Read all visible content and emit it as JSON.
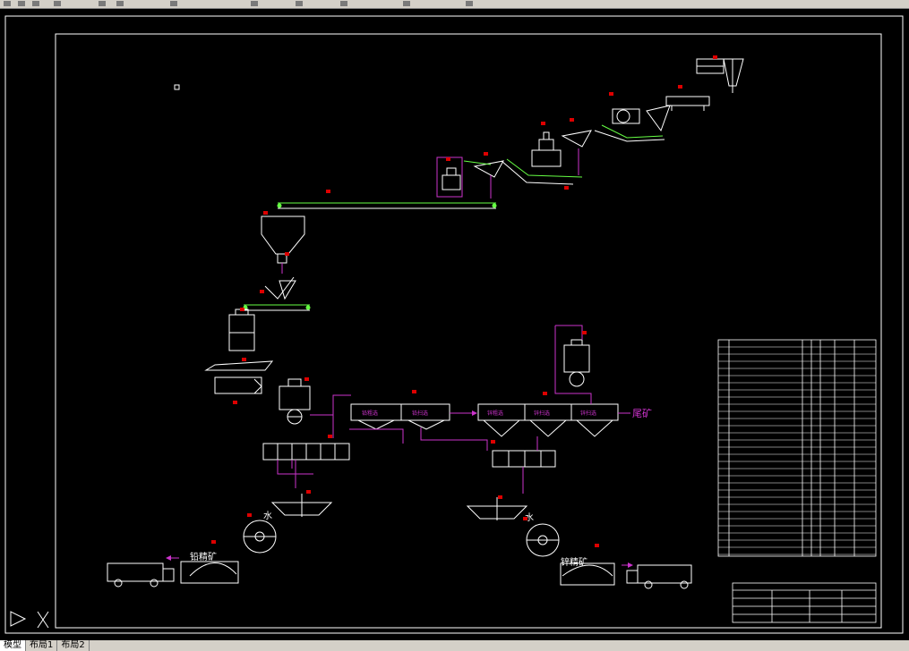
{
  "tabs": [
    {
      "label": "模型"
    },
    {
      "label": "布局1"
    },
    {
      "label": "布局2"
    }
  ],
  "diagram": {
    "labels": {
      "tailings": "尾矿",
      "water": "水",
      "concentrate_lead": "铅精矿",
      "concentrate_zinc": "锌精矿"
    }
  },
  "colors": {
    "background": "#000000",
    "frame": "#ffffff",
    "pipe": "#cc33cc",
    "conveyor": "#66ff44",
    "tag": "#dd0000"
  }
}
